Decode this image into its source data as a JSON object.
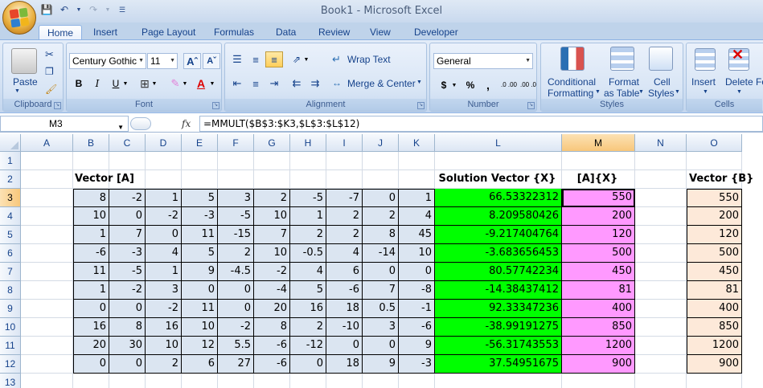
{
  "title": "Book1 - Microsoft Excel",
  "colors": {
    "matrix": "#dbe5f1",
    "solution": "#00ff00",
    "product": "#ff99ff",
    "vectorB": "#fde9d9",
    "header_selected": "#f8c77b"
  },
  "tabs": [
    "Home",
    "Insert",
    "Page Layout",
    "Formulas",
    "Data",
    "Review",
    "View",
    "Developer"
  ],
  "active_tab": "Home",
  "ribbon": {
    "clipboard": {
      "label": "Clipboard",
      "paste": "Paste"
    },
    "font": {
      "label": "Font",
      "family": "Century Gothic",
      "size": "11",
      "bold": "B",
      "italic": "I",
      "underline": "U",
      "grow": "A",
      "shrink": "A"
    },
    "alignment": {
      "label": "Alignment",
      "wrap_text": "Wrap Text",
      "merge_center": "Merge & Center"
    },
    "number": {
      "label": "Number",
      "format": "General",
      "currency": "$",
      "percent": "%",
      "comma": ",",
      "inc_dec": ".0 .00",
      "dec_dec": ".00 .0"
    },
    "styles": {
      "label": "Styles",
      "conditional": "Conditional",
      "formatting": "Formatting",
      "format": "Format",
      "as_table": "as Table",
      "cell": "Cell",
      "styles": "Styles"
    },
    "cells": {
      "label": "Cells",
      "insert": "Insert",
      "delete": "Delete",
      "format": "Fo"
    }
  },
  "formula_bar": {
    "name_box": "M3",
    "fx": "fx",
    "formula": "=MMULT($B$3:$K3,$L$3:$L$12)"
  },
  "columns": [
    "A",
    "B",
    "C",
    "D",
    "E",
    "F",
    "G",
    "H",
    "I",
    "J",
    "K",
    "L",
    "M",
    "N",
    "O"
  ],
  "selected_column": "M",
  "rows": [
    "1",
    "2",
    "3",
    "4",
    "5",
    "6",
    "7",
    "8",
    "9",
    "10",
    "11",
    "12",
    "13"
  ],
  "selected_row": "3",
  "headers": {
    "matrix": "Vector [A]",
    "solution": "Solution Vector {X}",
    "product": "[A]{X}",
    "vectorB": "Vector {B}"
  },
  "matrix_A": [
    [
      "8",
      "-2",
      "1",
      "5",
      "3",
      "2",
      "-5",
      "-7",
      "0",
      "1"
    ],
    [
      "10",
      "0",
      "-2",
      "-3",
      "-5",
      "10",
      "1",
      "2",
      "2",
      "4"
    ],
    [
      "1",
      "7",
      "0",
      "11",
      "-15",
      "7",
      "2",
      "2",
      "8",
      "45"
    ],
    [
      "-6",
      "-3",
      "4",
      "5",
      "2",
      "10",
      "-0.5",
      "4",
      "-14",
      "10"
    ],
    [
      "11",
      "-5",
      "1",
      "9",
      "-4.5",
      "-2",
      "4",
      "6",
      "0",
      "0"
    ],
    [
      "1",
      "-2",
      "3",
      "0",
      "0",
      "-4",
      "5",
      "-6",
      "7",
      "-8"
    ],
    [
      "0",
      "0",
      "-2",
      "11",
      "0",
      "20",
      "16",
      "18",
      "0.5",
      "-1"
    ],
    [
      "16",
      "8",
      "16",
      "10",
      "-2",
      "8",
      "2",
      "-10",
      "3",
      "-6"
    ],
    [
      "20",
      "30",
      "10",
      "12",
      "5.5",
      "-6",
      "-12",
      "0",
      "0",
      "9"
    ],
    [
      "0",
      "0",
      "2",
      "6",
      "27",
      "-6",
      "0",
      "18",
      "9",
      "-3"
    ]
  ],
  "solution_X": [
    "66.53322312",
    "8.209580426",
    "-9.217404764",
    "-3.683656453",
    "80.57742234",
    "-14.38437412",
    "92.33347236",
    "-38.99191275",
    "-56.31743553",
    "37.54951675"
  ],
  "product_AX": [
    "550",
    "200",
    "120",
    "500",
    "450",
    "81",
    "400",
    "850",
    "1200",
    "900"
  ],
  "vector_B": [
    "550",
    "200",
    "120",
    "500",
    "450",
    "81",
    "400",
    "850",
    "1200",
    "900"
  ]
}
